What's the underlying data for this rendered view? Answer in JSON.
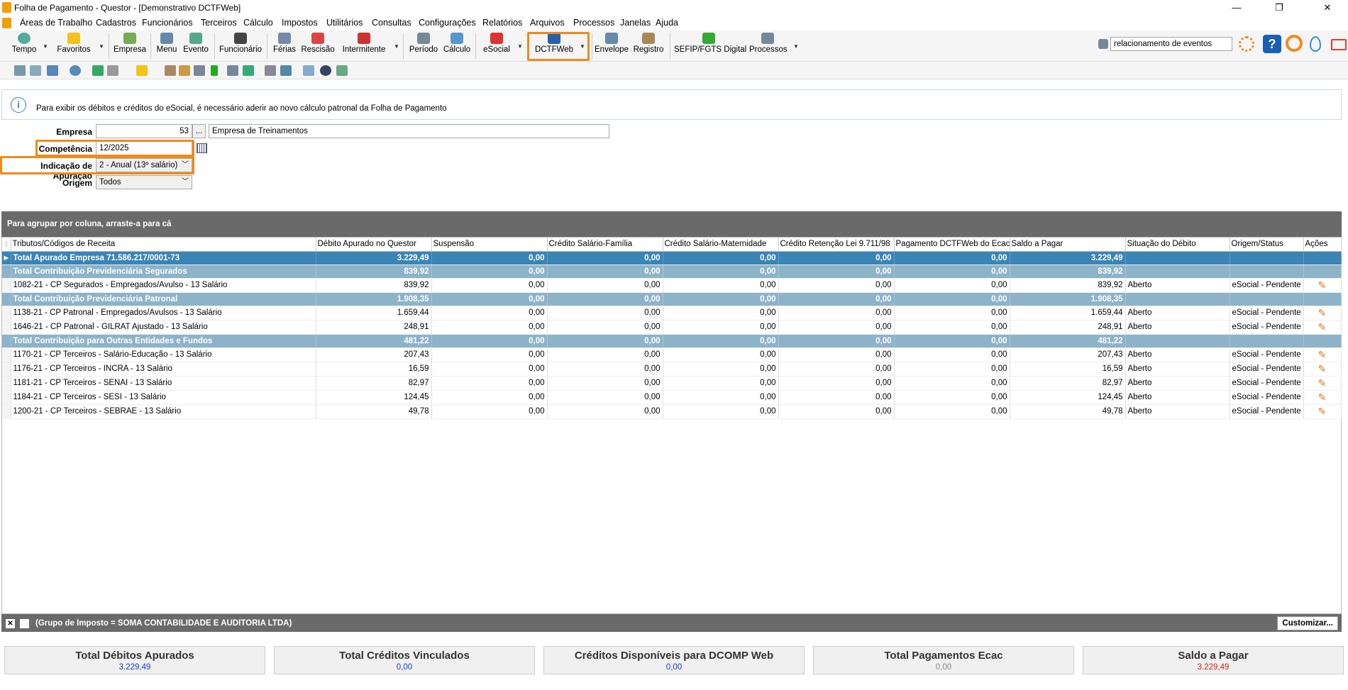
{
  "window": {
    "title": "Folha de Pagamento - Questor - [Demonstrativo DCTFWeb]",
    "min": "—",
    "max": "❐",
    "close": "✕"
  },
  "menu": [
    "Áreas de Trabalho",
    "Cadastros",
    "Funcionários",
    "Terceiros",
    "Cálculo",
    "Impostos",
    "Utilitários",
    "Consultas",
    "Configurações",
    "Relatórios",
    "Arquivos",
    "Processos",
    "Janelas",
    "Ajuda"
  ],
  "toolbar": {
    "buttons": [
      {
        "label": "Tempo",
        "icon": "clock-icon",
        "color": "#5a9"
      },
      {
        "label": "Favoritos",
        "icon": "star-icon",
        "color": "#f3c21b"
      },
      {
        "label": "Empresa",
        "icon": "building-icon",
        "color": "#7a5"
      },
      {
        "label": "Menu",
        "icon": "menu-icon",
        "color": "#68a"
      },
      {
        "label": "Evento",
        "icon": "event-icon",
        "color": "#5a8"
      },
      {
        "label": "Funcionário",
        "icon": "person-icon",
        "color": "#444"
      },
      {
        "label": "Férias",
        "icon": "vacation-icon",
        "color": "#78a"
      },
      {
        "label": "Rescisão",
        "icon": "termination-icon",
        "color": "#d44"
      },
      {
        "label": "Intermitente",
        "icon": "intermittent-icon",
        "color": "#c33"
      },
      {
        "label": "Período",
        "icon": "period-icon",
        "color": "#789"
      },
      {
        "label": "Cálculo",
        "icon": "calculation-icon",
        "color": "#59c"
      },
      {
        "label": "eSocial",
        "icon": "esocial-icon",
        "color": "#d33"
      },
      {
        "label": "DCTFWeb",
        "icon": "dctfweb-icon",
        "color": "#2a5fa8"
      },
      {
        "label": "Envelope",
        "icon": "envelope-icon",
        "color": "#68a"
      },
      {
        "label": "Registro",
        "icon": "register-icon",
        "color": "#a85"
      },
      {
        "label": "SEFIP/FGTS Digital",
        "icon": "sefip-icon",
        "color": "#3a3"
      },
      {
        "label": "Processos",
        "icon": "processes-icon",
        "color": "#789"
      }
    ],
    "search_value": "relacionamento de eventos"
  },
  "info_message": "Para exibir os débitos e créditos do eSocial, é necessário aderir ao novo cálculo patronal da Folha de Pagamento",
  "form": {
    "empresa_label": "Empresa",
    "empresa_code": "53",
    "empresa_btn": "...",
    "empresa_name": "Empresa de Treinamentos",
    "competencia_label": "Competência",
    "competencia_value": "12/2025",
    "apuracao_label": "Indicação de Apuração",
    "apuracao_value": "2 - Anual (13º salário)",
    "origem_label": "Origem",
    "origem_value": "Todos"
  },
  "group_panel": "Para agrupar por coluna, arraste-a para cá",
  "grid": {
    "columns": [
      "Tributos/Códigos de Receita",
      "Débito Apurado no Questor",
      "Suspensão",
      "Crédito Salário-Família",
      "Crédito Salário-Maternidade",
      "Crédito Retenção Lei 9.711/98",
      "Pagamento DCTFWeb do Ecac",
      "Saldo a Pagar",
      "Situação do Débito",
      "Origem/Status",
      "Ações"
    ],
    "rows": [
      {
        "t": "tot1",
        "c": [
          "Total Apurado Empresa 71.586.217/0001-73",
          "3.229,49",
          "0,00",
          "0,00",
          "0,00",
          "0,00",
          "0,00",
          "3.229,49",
          "",
          ""
        ]
      },
      {
        "t": "tot2",
        "c": [
          "Total Contribuição Previdenciária Segurados",
          "839,92",
          "0,00",
          "0,00",
          "0,00",
          "0,00",
          "0,00",
          "839,92",
          "",
          ""
        ]
      },
      {
        "t": "row",
        "c": [
          "1082-21 - CP Segurados - Empregados/Avulso - 13 Salário",
          "839,92",
          "0,00",
          "0,00",
          "0,00",
          "0,00",
          "0,00",
          "839,92",
          "Aberto",
          "eSocial - Pendente"
        ]
      },
      {
        "t": "tot2",
        "c": [
          "Total Contribuição Previdenciária Patronal",
          "1.908,35",
          "0,00",
          "0,00",
          "0,00",
          "0,00",
          "0,00",
          "1.908,35",
          "",
          ""
        ]
      },
      {
        "t": "row",
        "c": [
          "1138-21 - CP Patronal - Empregados/Avulsos - 13 Salário",
          "1.659,44",
          "0,00",
          "0,00",
          "0,00",
          "0,00",
          "0,00",
          "1.659,44",
          "Aberto",
          "eSocial - Pendente"
        ]
      },
      {
        "t": "row",
        "c": [
          "1646-21 - CP Patronal - GILRAT Ajustado - 13 Salário",
          "248,91",
          "0,00",
          "0,00",
          "0,00",
          "0,00",
          "0,00",
          "248,91",
          "Aberto",
          "eSocial - Pendente"
        ]
      },
      {
        "t": "tot2",
        "c": [
          "Total Contribuição para Outras Entidades e Fundos",
          "481,22",
          "0,00",
          "0,00",
          "0,00",
          "0,00",
          "0,00",
          "481,22",
          "",
          ""
        ]
      },
      {
        "t": "row",
        "c": [
          "1170-21 - CP Terceiros - Salário-Educação - 13 Salário",
          "207,43",
          "0,00",
          "0,00",
          "0,00",
          "0,00",
          "0,00",
          "207,43",
          "Aberto",
          "eSocial - Pendente"
        ]
      },
      {
        "t": "row",
        "c": [
          "1176-21 - CP Terceiros - INCRA - 13 Salário",
          "16,59",
          "0,00",
          "0,00",
          "0,00",
          "0,00",
          "0,00",
          "16,59",
          "Aberto",
          "eSocial - Pendente"
        ]
      },
      {
        "t": "row",
        "c": [
          "1181-21 - CP Terceiros - SENAI - 13 Salário",
          "82,97",
          "0,00",
          "0,00",
          "0,00",
          "0,00",
          "0,00",
          "82,97",
          "Aberto",
          "eSocial - Pendente"
        ]
      },
      {
        "t": "row",
        "c": [
          "1184-21 - CP Terceiros - SESI - 13 Salário",
          "124,45",
          "0,00",
          "0,00",
          "0,00",
          "0,00",
          "0,00",
          "124,45",
          "Aberto",
          "eSocial - Pendente"
        ]
      },
      {
        "t": "row",
        "c": [
          "1200-21 - CP Terceiros - SEBRAE - 13 Salário",
          "49,78",
          "0,00",
          "0,00",
          "0,00",
          "0,00",
          "0,00",
          "49,78",
          "Aberto",
          "eSocial - Pendente"
        ]
      }
    ]
  },
  "filter": {
    "text": "(Grupo de Imposto = SOMA CONTABILIDADE E AUDITORIA LTDA)",
    "customize": "Customizar..."
  },
  "summary": [
    {
      "title": "Total Débitos Apurados",
      "value": "3.229,49",
      "color": "#1a3cc8"
    },
    {
      "title": "Total Créditos Vinculados",
      "value": "0,00",
      "color": "#1a3cc8"
    },
    {
      "title": "Créditos Disponíveis para DCOMP Web",
      "value": "0,00",
      "color": "#1a3cc8"
    },
    {
      "title": "Total Pagamentos Ecac",
      "value": "0,00",
      "color": "#888888"
    },
    {
      "title": "Saldo a Pagar",
      "value": "3.229,49",
      "color": "#d42020"
    }
  ]
}
